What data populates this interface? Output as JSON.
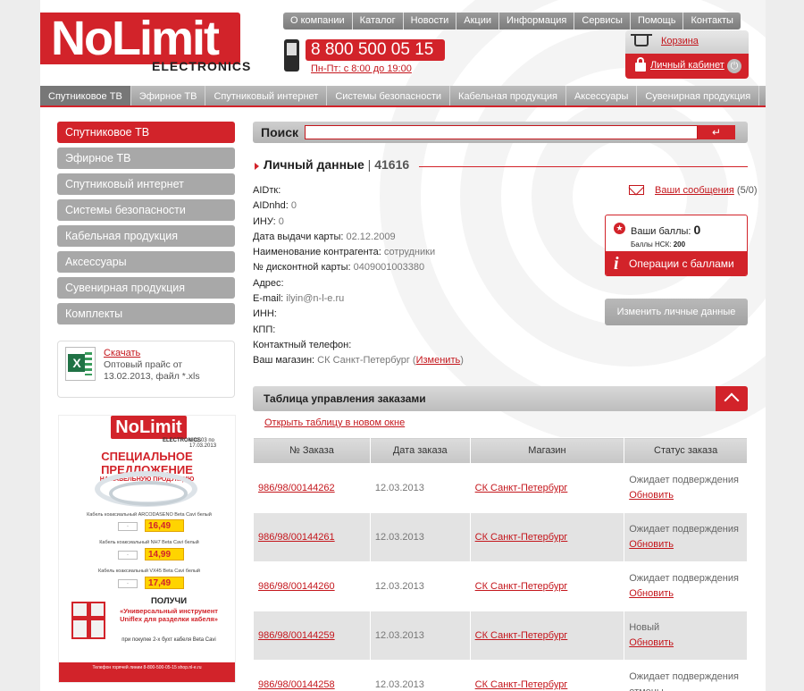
{
  "logo": {
    "brand": "NoLimit",
    "sub": "ELECTRONICS"
  },
  "top_nav": [
    "О компании",
    "Каталог",
    "Новости",
    "Акции",
    "Информация",
    "Сервисы",
    "Помощь",
    "Контакты"
  ],
  "phone": {
    "number": "8 800 500 05 15",
    "hours": "Пн-Пт: с 8:00 до 19:00"
  },
  "user_box": {
    "cart": "Корзина",
    "cabinet": "Личный кабинет"
  },
  "main_nav": [
    {
      "label": "Спутниковое ТВ",
      "active": true
    },
    {
      "label": "Эфирное ТВ"
    },
    {
      "label": "Спутниковый интернет"
    },
    {
      "label": "Системы безопасности"
    },
    {
      "label": "Кабельная продукция"
    },
    {
      "label": "Аксессуары"
    },
    {
      "label": "Сувенирная продукция"
    }
  ],
  "sidebar": [
    "Спутниковое ТВ",
    "Эфирное ТВ",
    "Спутниковый интернет",
    "Системы безопасности",
    "Кабельная продукция",
    "Аксессуары",
    "Сувенирная продукция",
    "Комплекты"
  ],
  "price": {
    "download": "Скачать",
    "text": "Оптовый прайс от 13.02.2013, файл *.xls"
  },
  "promo": {
    "logo": "NoLimit",
    "sub": "ELECTRONICS",
    "date": "с 01.03 по 17.03.2013",
    "title": "СПЕЦИАЛЬНОЕ ПРЕДЛОЖЕНИЕ",
    "subtitle": "НА КАБЕЛЬНУЮ ПРОДУКЦИЮ",
    "item1": "Кабель коаксиальный ARCODASENO Beta Cavi белый",
    "price1": "16,49",
    "item2": "Кабель коаксиальный NH7 Beta Cavi белый",
    "price2": "14,99",
    "item3": "Кабель коаксиальный VX45 Beta Cavi белый",
    "price3": "17,49",
    "get": "ПОЛУЧИ",
    "get2": "«Универсальный инструмент Uniflex для разделки кабеля»",
    "get3": "при покупке 2-х бухт кабеля Beta Cavi",
    "footer": "Телефон горячей линии 8-800-500-05-15 shop.nl-e.ru"
  },
  "search": {
    "label": "Поиск",
    "placeholder": "",
    "button": "↵"
  },
  "page_title": {
    "text": "Личный данные",
    "sep": " | ",
    "id": "41616"
  },
  "personal": [
    {
      "label": "AIDтк:",
      "value": ""
    },
    {
      "label": "AIDnhd:",
      "value": "0"
    },
    {
      "label": "ИНУ:",
      "value": "0"
    },
    {
      "label": "Дата выдачи карты:",
      "value": "02.12.2009"
    },
    {
      "label": "Наименование контрагента:",
      "value": "сотрудники"
    },
    {
      "label": "№ дисконтной карты:",
      "value": "0409001003380"
    },
    {
      "label": "Адрес:",
      "value": ""
    },
    {
      "label": "E-mail:",
      "value": "ilyin@n-l-e.ru"
    },
    {
      "label": "ИНН:",
      "value": ""
    },
    {
      "label": "КПП:",
      "value": ""
    },
    {
      "label": "Контактный телефон:",
      "value": ""
    },
    {
      "label": "Ваш магазин:",
      "value": "СК Санкт-Петербург",
      "link": "Изменить"
    }
  ],
  "messages": {
    "link": "Ваши сообщения",
    "count": "(5/0)"
  },
  "score": {
    "label": "Ваши баллы:",
    "value": "0",
    "nsk_label": "Баллы НСК:",
    "nsk_value": "200",
    "button": "Операции с баллами"
  },
  "edit_button": "Изменить личные данные",
  "orders": {
    "title": "Таблица управления заказами",
    "open_new": "Открыть таблицу в новом окне",
    "columns": [
      "№ Заказа",
      "Дата заказа",
      "Магазин",
      "Статус заказа"
    ],
    "rows": [
      {
        "id": "986/98/00144262",
        "date": "12.03.2013",
        "shop": "СК Санкт-Петербург",
        "status": "Ожидает подверждения",
        "action": "Обновить"
      },
      {
        "id": "986/98/00144261",
        "date": "12.03.2013",
        "shop": "СК Санкт-Петербург",
        "status": "Ожидает подверждения",
        "action": "Обновить"
      },
      {
        "id": "986/98/00144260",
        "date": "12.03.2013",
        "shop": "СК Санкт-Петербург",
        "status": "Ожидает подверждения",
        "action": "Обновить"
      },
      {
        "id": "986/98/00144259",
        "date": "12.03.2013",
        "shop": "СК Санкт-Петербург",
        "status": "Новый",
        "action": "Обновить"
      },
      {
        "id": "986/98/00144258",
        "date": "12.03.2013",
        "shop": "СК Санкт-Петербург",
        "status": "Ожидает подверждения отмены",
        "action": ""
      }
    ]
  },
  "colors": {
    "accent": "#d2232a",
    "nav_gray": "#a8a8a8",
    "link": "#c4161c"
  }
}
